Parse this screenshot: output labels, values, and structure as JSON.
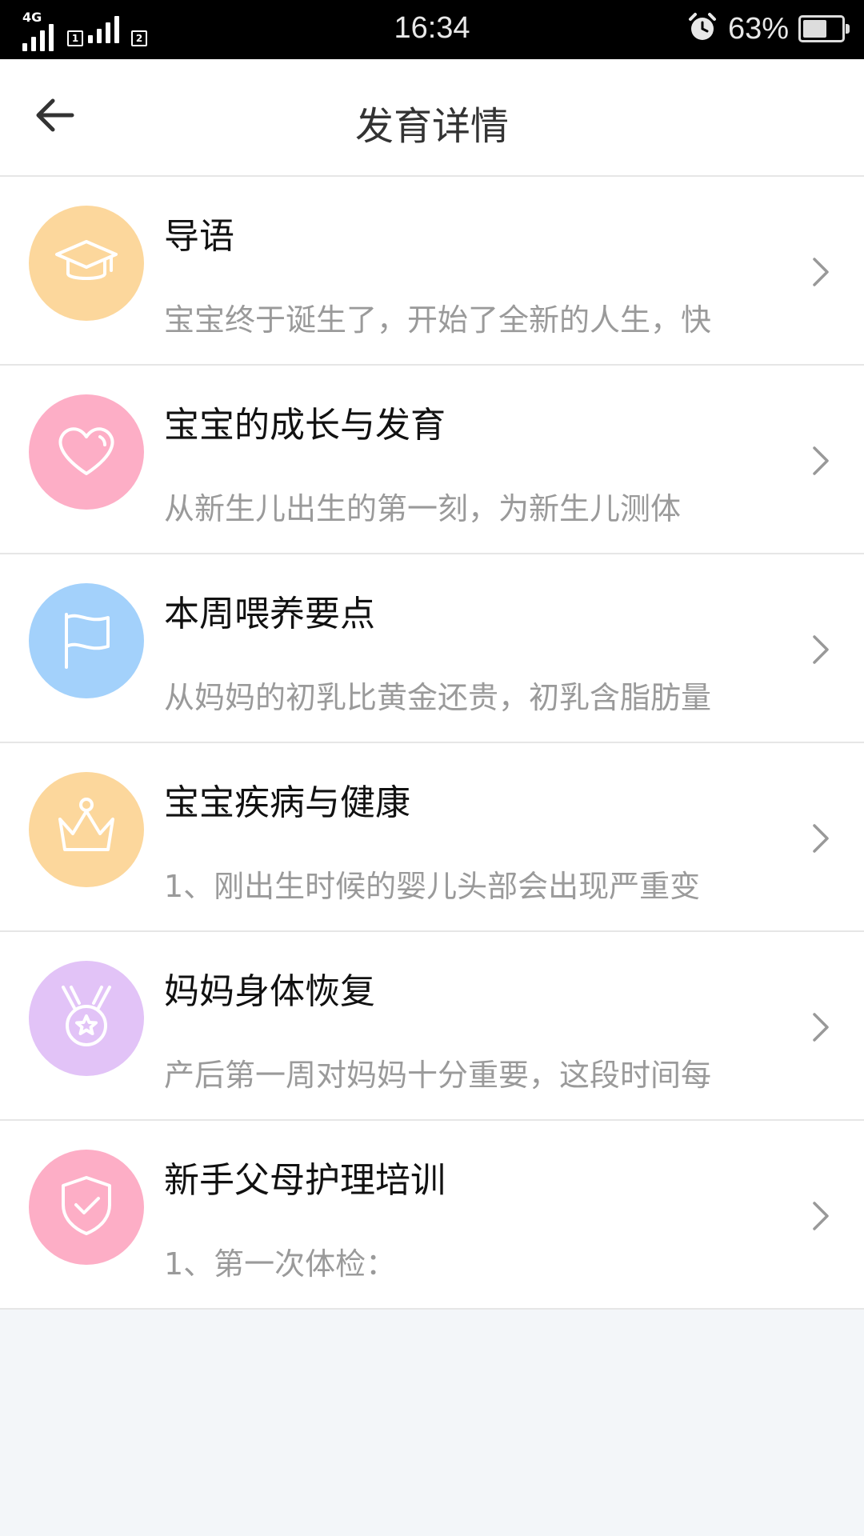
{
  "status_bar": {
    "network": "4G",
    "sim1": "1",
    "sim2": "2",
    "time": "16:34",
    "battery_percent": "63%",
    "battery_level": 0.63,
    "alarm_icon": "alarm-clock-icon"
  },
  "header": {
    "title": "发育详情",
    "back_icon": "arrow-left-icon"
  },
  "items": [
    {
      "title": "导语",
      "summary": "宝宝终于诞生了，开始了全新的人生，快",
      "icon": "graduation-cap-icon",
      "color": "#fcd79c"
    },
    {
      "title": "宝宝的成长与发育",
      "summary": "从新生儿出生的第一刻，为新生儿测体",
      "icon": "heart-icon",
      "color": "#fdaec6"
    },
    {
      "title": "本周喂养要点",
      "summary": "从妈妈的初乳比黄金还贵，初乳含脂肪量",
      "icon": "flag-icon",
      "color": "#a3d1fb"
    },
    {
      "title": "宝宝疾病与健康",
      "summary": "1、刚出生时候的婴儿头部会出现严重变",
      "icon": "crown-icon",
      "color": "#fcd79c"
    },
    {
      "title": "妈妈身体恢复",
      "summary": "产后第一周对妈妈十分重要，这段时间每",
      "icon": "medal-icon",
      "color": "#e2c3f7"
    },
    {
      "title": "新手父母护理培训",
      "summary": "1、第一次体检：",
      "icon": "shield-check-icon",
      "color": "#fdaec6"
    }
  ],
  "colors": {
    "page_background": "#f3f6f9",
    "title_text": "#111111",
    "summary_text": "#9a9a9a",
    "chevron": "#999999"
  }
}
